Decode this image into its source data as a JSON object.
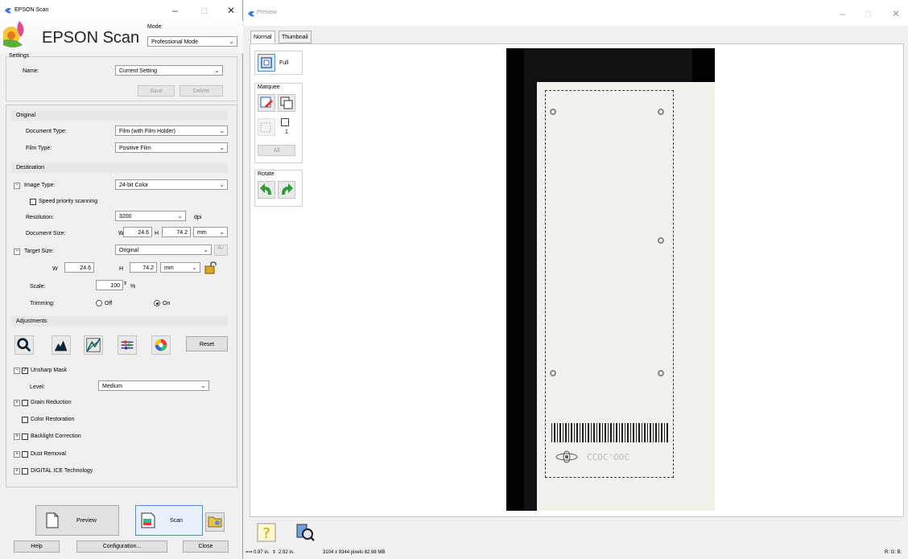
{
  "scan_window": {
    "title": "EPSON Scan",
    "logo": "EPSON Scan",
    "mode_label": "Mode:",
    "mode_value": "Professional Mode",
    "settings": {
      "group": "Settings",
      "name_label": "Name:",
      "name_value": "Current Setting",
      "save": "Save",
      "delete": "Delete"
    },
    "original": {
      "header": "Original",
      "doc_type_label": "Document Type:",
      "doc_type_value": "Film (with Film Holder)",
      "film_type_label": "Film Type:",
      "film_type_value": "Positive Film"
    },
    "destination": {
      "header": "Destination",
      "image_type_label": "Image Type:",
      "image_type_value": "24-bit Color",
      "speed_priority": "Speed priority scanning",
      "resolution_label": "Resolution:",
      "resolution_value": "3200",
      "dpi": "dpi",
      "doc_size_label": "Document Size:",
      "w": "W",
      "h": "H",
      "doc_w": "24.6",
      "doc_h": "74.2",
      "unit": "mm",
      "target_size_label": "Target Size:",
      "target_size_value": "Original",
      "target_w": "24.6",
      "target_h": "74.2",
      "target_unit": "mm",
      "scale_label": "Scale:",
      "scale_value": "100",
      "percent": "%",
      "trimming_label": "Trimming:",
      "trim_off": "Off",
      "trim_on": "On"
    },
    "adjustments": {
      "header": "Adjustments",
      "reset": "Reset",
      "unsharp_mask": "Unsharp Mask",
      "level_label": "Level:",
      "level_value": "Medium",
      "grain_reduction": "Grain Reduction",
      "color_restoration": "Color Restoration",
      "backlight_correction": "Backlight Correction",
      "dust_removal": "Dust Removal",
      "digital_ice": "DIGITAL ICE Technology"
    },
    "bottom": {
      "preview": "Preview",
      "scan": "Scan",
      "help": "Help",
      "configuration": "Configuration...",
      "close": "Close"
    }
  },
  "preview_window": {
    "title": "Preview",
    "tabs": [
      "Normal",
      "Thumbnail"
    ],
    "full": "Full",
    "marquee": "Marquee",
    "marquee_count": "1",
    "all": "All",
    "rotate": "Rotate",
    "status_size": "0.97 in.",
    "status_size2": "2.92 in.",
    "status_pixels": "3104 x 9344 pixels 82.98 MB",
    "status_rgb": "R: G: B:",
    "film_code": "CCOC'OOC"
  }
}
